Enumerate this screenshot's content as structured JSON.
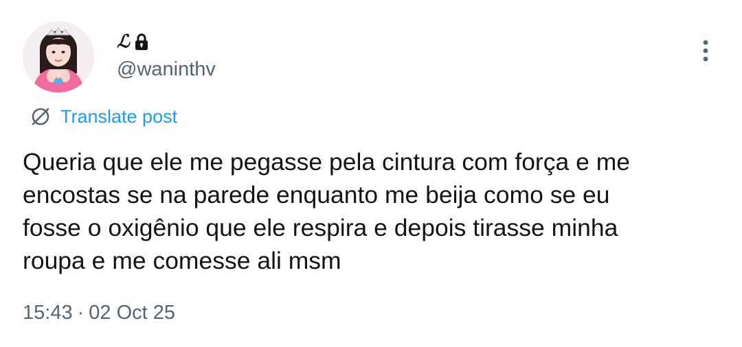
{
  "author": {
    "display_name": "ℒ",
    "handle": "@waninthv",
    "protected": true,
    "avatar_icon": "profile-photo"
  },
  "translate": {
    "label": "Translate post",
    "icon": "translate-globe-icon",
    "color": "#1d9bf0"
  },
  "post": {
    "text": "Queria que ele me pegasse pela cintura com força e me\nencostas se na parede enquanto me beija como se eu\nfosse o oxigênio que ele respira e depois tirasse minha\nroupa e me comesse ali msm"
  },
  "meta": {
    "time": "15:43",
    "separator": "·",
    "date": "02 Oct 25"
  },
  "colors": {
    "text": "#0f1419",
    "secondary": "#536471",
    "accent": "#1d9bf0",
    "background": "#ffffff"
  }
}
